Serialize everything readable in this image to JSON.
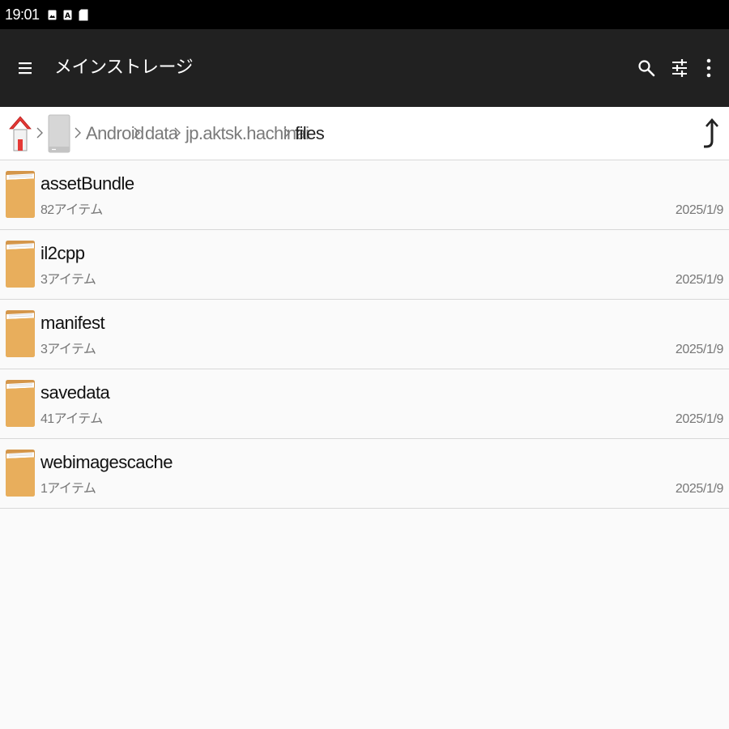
{
  "status_bar": {
    "time": "19:01",
    "icons": [
      "image-notification-icon",
      "text-notification-icon",
      "sd-card-icon"
    ]
  },
  "app_bar": {
    "title": "メインストレージ",
    "menu_icon": "hamburger-menu-icon",
    "actions": [
      "search-icon",
      "filter-sliders-icon",
      "more-vert-icon"
    ]
  },
  "breadcrumb": {
    "home_icon": "home-icon",
    "drive_icon": "storage-drive-icon",
    "segments": [
      "Android",
      "data",
      "jp.aktsk.hachinai",
      "files"
    ],
    "up_icon": "navigate-up-icon"
  },
  "files": [
    {
      "name": "assetBundle",
      "count": "82アイテム",
      "date": "2025/1/9"
    },
    {
      "name": "il2cpp",
      "count": "3アイテム",
      "date": "2025/1/9"
    },
    {
      "name": "manifest",
      "count": "3アイテム",
      "date": "2025/1/9"
    },
    {
      "name": "savedata",
      "count": "41アイテム",
      "date": "2025/1/9"
    },
    {
      "name": "webimagescache",
      "count": "1アイテム",
      "date": "2025/1/9"
    }
  ],
  "colors": {
    "status_bar": "#000000",
    "app_bar": "#212121",
    "folder": "#E8AE5C",
    "home_roof": "#E53935"
  }
}
